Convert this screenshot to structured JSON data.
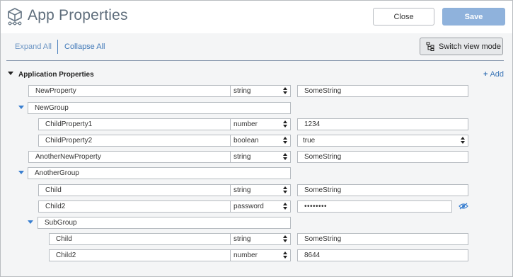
{
  "header": {
    "title": "App Properties",
    "close_label": "Close",
    "save_label": "Save",
    "icon": "app-package-icon"
  },
  "toolbar": {
    "expand_all": "Expand All",
    "collapse_all": "Collapse All",
    "switch_view": "Switch view mode",
    "switch_icon": "tree-view-icon"
  },
  "section": {
    "title": "Application Properties",
    "add_label": "Add"
  },
  "rows": [
    {
      "name": "NewProperty",
      "type": "string",
      "value": "SomeString"
    },
    {
      "group": "NewGroup"
    },
    {
      "name": "ChildProperty1",
      "type": "number",
      "value": "1234"
    },
    {
      "name": "ChildProperty2",
      "type": "boolean",
      "value": "true"
    },
    {
      "name": "AnotherNewProperty",
      "type": "string",
      "value": "SomeString"
    },
    {
      "group": "AnotherGroup"
    },
    {
      "name": "Child",
      "type": "string",
      "value": "SomeString"
    },
    {
      "name": "Child2",
      "type": "password",
      "value": "••••••••"
    },
    {
      "group": "SubGroup"
    },
    {
      "name": "Child",
      "type": "string",
      "value": "SomeString"
    },
    {
      "name": "Child2",
      "type": "number",
      "value": "8644"
    }
  ],
  "colors": {
    "accent": "#3f78b8",
    "save_button": "#8fb2dc"
  }
}
